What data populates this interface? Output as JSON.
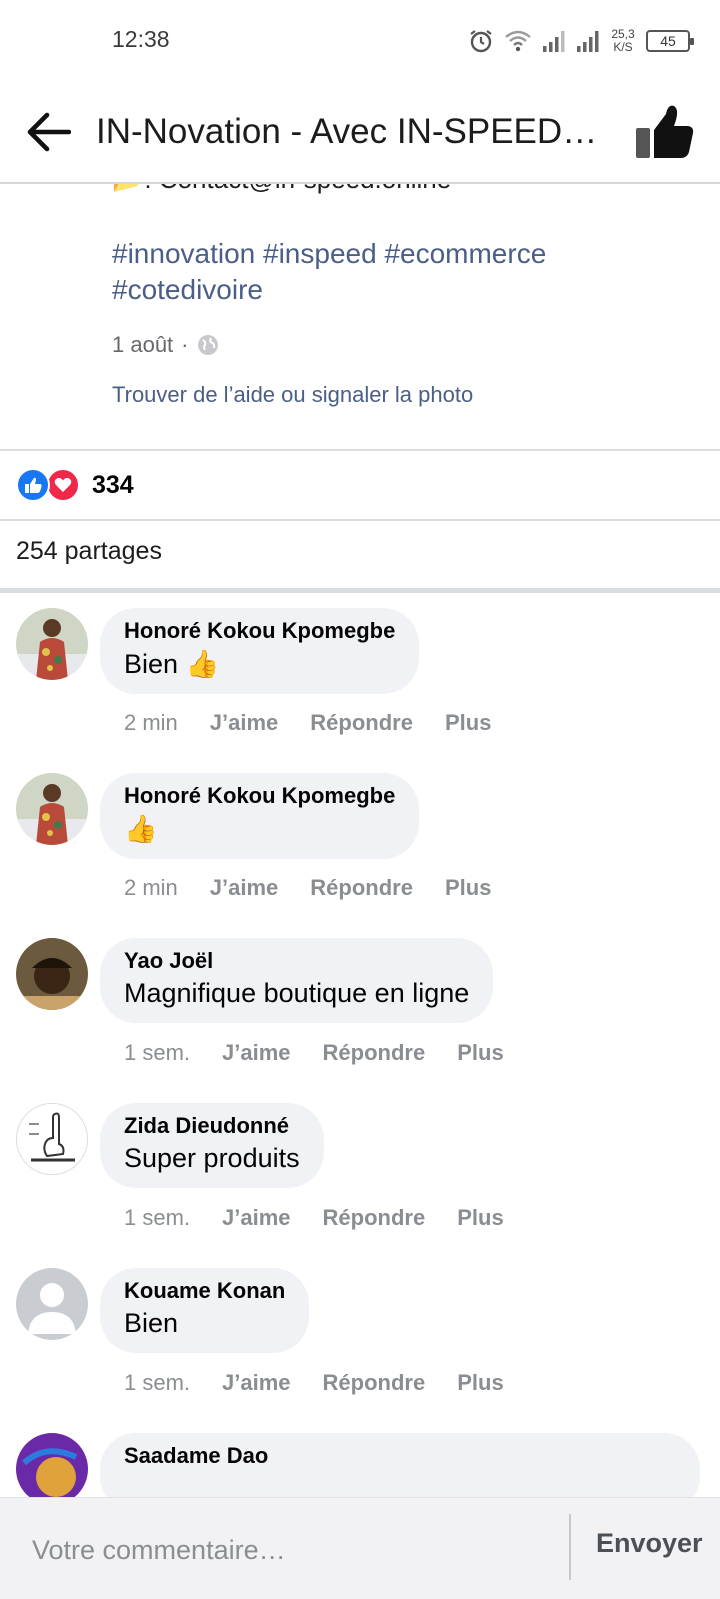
{
  "status_bar": {
    "time": "12:38",
    "net_speed_value": "25,3",
    "net_speed_unit": "K/S",
    "battery": "45",
    "icons": [
      "alarm-icon",
      "wifi-icon",
      "signal-icon",
      "signal-icon"
    ]
  },
  "header": {
    "title": "IN-Novation - Avec IN-SPEED t…",
    "back_icon": "back-arrow-icon",
    "like_icon": "thumbs-up-icon"
  },
  "post": {
    "contact": "📂: Contact@in-speed.online",
    "hashtags": "#innovation #inspeed #ecommerce #cotedivoire",
    "date": "1 août",
    "meta_separator": "·",
    "help_link": "Trouver de l’aide ou signaler la photo"
  },
  "reactions": {
    "count": "334",
    "types": [
      "like",
      "love"
    ]
  },
  "shares": "254 partages",
  "actions": {
    "like": "J’aime",
    "reply": "Répondre",
    "more": "Plus"
  },
  "comments": [
    {
      "author": "Honoré Kokou Kpomegbe",
      "text": "Bien 👍",
      "time": "2 min"
    },
    {
      "author": "Honoré Kokou Kpomegbe",
      "text": "👍",
      "time": "2 min"
    },
    {
      "author": "Yao Joël",
      "text": "Magnifique boutique en ligne",
      "time": "1 sem."
    },
    {
      "author": "Zida Dieudonné",
      "text": "Super produits",
      "time": "1 sem."
    },
    {
      "author": "Kouame Konan",
      "text": "Bien",
      "time": "1 sem."
    },
    {
      "author": "Saadame Dao",
      "text": "",
      "time": ""
    }
  ],
  "composer": {
    "placeholder": "Votre commentaire…",
    "send_label": "Envoyer"
  },
  "colors": {
    "link": "#4a5e86",
    "bubble": "#f0f2f5",
    "like_blue": "#1877f2",
    "love_red": "#f02849"
  }
}
